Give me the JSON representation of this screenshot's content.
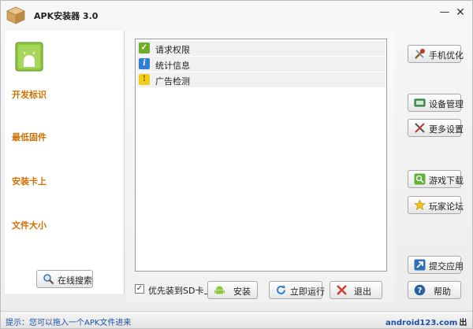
{
  "window": {
    "title": "APK安装器 3.0",
    "minimize_label": "—",
    "close_label": "✕"
  },
  "left": {
    "labels": [
      "开发标识",
      "最低固件",
      "安装卡上",
      "文件大小"
    ],
    "online_search": "在线搜索"
  },
  "permissions": [
    {
      "label": "请求权限",
      "icon": "check-icon"
    },
    {
      "label": "统计信息",
      "icon": "info-icon"
    },
    {
      "label": "广告检测",
      "icon": "warning-icon"
    }
  ],
  "options": {
    "prefer_sd_label": "优先装到SD卡上",
    "prefer_sd_checked": true,
    "check_mark": "✓"
  },
  "actions": {
    "install": "安装",
    "run_now": "立即运行",
    "exit": "退出"
  },
  "right": {
    "optimize": "手机优化",
    "device_manage": "设备管理",
    "more_settings": "更多设置",
    "game_download": "游戏下载",
    "player_forum": "玩家论坛",
    "submit_app": "提交应用",
    "help": "帮助"
  },
  "status": {
    "tip": "提示：您可以拖入一个APK文件进来",
    "brand": "android123.com",
    "brand_suffix": "出品"
  },
  "colors": {
    "accent_orange": "#d07000",
    "status_blue": "#1e4fa8"
  }
}
